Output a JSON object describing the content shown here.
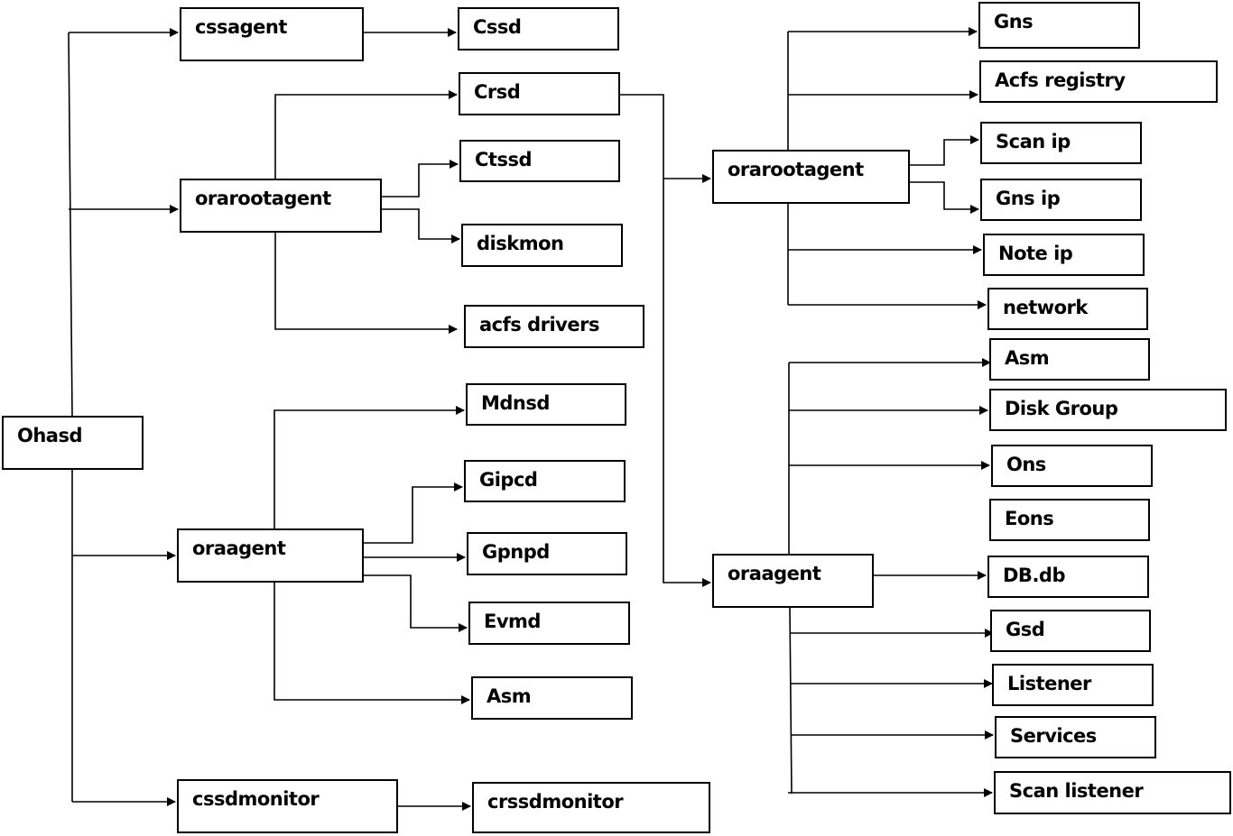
{
  "nodes": {
    "ohasd": "Ohasd",
    "cssagent": "cssagent",
    "cssd": "Cssd",
    "crsd": "Crsd",
    "orarootagent_l": "orarootagent",
    "ctssd": "Ctssd",
    "diskmon": "diskmon",
    "acfs_drivers": "acfs drivers",
    "mdnsd": "Mdnsd",
    "gipcd": "Gipcd",
    "oraagent_l": "oraagent",
    "gpnpd": "Gpnpd",
    "evmd": "Evmd",
    "asm_l": "Asm",
    "cssdmonitor": "cssdmonitor",
    "crssdmonitor": "crssdmonitor",
    "orarootagent_r": "orarootagent",
    "oraagent_r": "oraagent",
    "gns": "Gns",
    "acfs_registry": "Acfs registry",
    "scan_ip": "Scan ip",
    "gns_ip": "Gns ip",
    "note_ip": "Note ip",
    "network": "network",
    "asm_r": "Asm",
    "disk_group": "Disk Group",
    "ons": "Ons",
    "eons": "Eons",
    "db_db": "DB.db",
    "gsd": "Gsd",
    "listener": "Listener",
    "services": "Services",
    "scan_listener": "Scan listener"
  },
  "edges": [
    [
      "ohasd",
      "cssagent"
    ],
    [
      "ohasd",
      "orarootagent_l"
    ],
    [
      "ohasd",
      "oraagent_l"
    ],
    [
      "ohasd",
      "cssdmonitor"
    ],
    [
      "cssagent",
      "cssd"
    ],
    [
      "orarootagent_l",
      "crsd"
    ],
    [
      "orarootagent_l",
      "ctssd"
    ],
    [
      "orarootagent_l",
      "diskmon"
    ],
    [
      "orarootagent_l",
      "acfs_drivers"
    ],
    [
      "oraagent_l",
      "mdnsd"
    ],
    [
      "oraagent_l",
      "gipcd"
    ],
    [
      "oraagent_l",
      "gpnpd"
    ],
    [
      "oraagent_l",
      "evmd"
    ],
    [
      "oraagent_l",
      "asm_l"
    ],
    [
      "cssdmonitor",
      "crssdmonitor"
    ],
    [
      "crsd",
      "orarootagent_r"
    ],
    [
      "crsd",
      "oraagent_r"
    ],
    [
      "orarootagent_r",
      "gns"
    ],
    [
      "orarootagent_r",
      "acfs_registry"
    ],
    [
      "orarootagent_r",
      "scan_ip"
    ],
    [
      "orarootagent_r",
      "gns_ip"
    ],
    [
      "orarootagent_r",
      "note_ip"
    ],
    [
      "orarootagent_r",
      "network"
    ],
    [
      "oraagent_r",
      "asm_r"
    ],
    [
      "oraagent_r",
      "disk_group"
    ],
    [
      "oraagent_r",
      "ons"
    ],
    [
      "oraagent_r",
      "db_db"
    ],
    [
      "oraagent_r",
      "gsd"
    ],
    [
      "oraagent_r",
      "listener"
    ],
    [
      "oraagent_r",
      "services"
    ],
    [
      "oraagent_r",
      "scan_listener"
    ]
  ]
}
